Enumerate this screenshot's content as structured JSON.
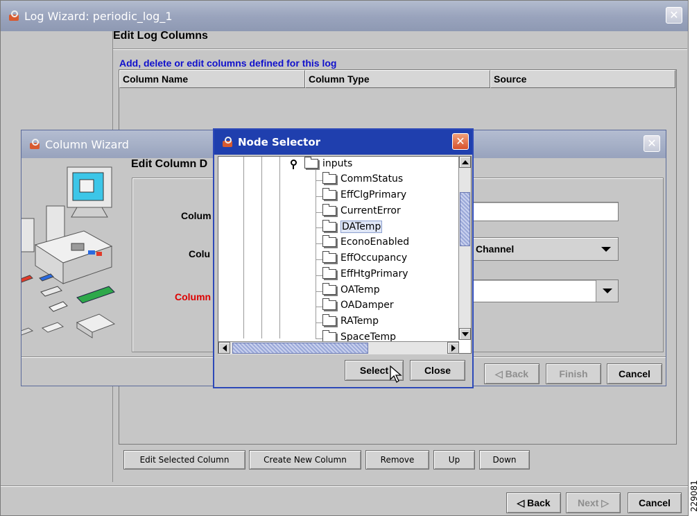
{
  "main_window": {
    "title": "Log Wizard: periodic_log_1",
    "step_heading": "Edit Log Columns",
    "caption": "Add, delete or edit columns defined for this log",
    "table": {
      "columns": [
        "Column Name",
        "Column Type",
        "Source"
      ]
    },
    "column_buttons": {
      "edit": "Edit Selected Column",
      "create": "Create New Column",
      "remove": "Remove",
      "up": "Up",
      "down": "Down"
    },
    "nav_buttons": {
      "back": "◁ Back",
      "next": "Next ▷",
      "cancel": "Cancel"
    }
  },
  "column_wizard": {
    "title": "Column Wizard",
    "step_heading": "Edit Column D",
    "labels": {
      "name": "Colum",
      "type": "Colu",
      "source": "Column"
    },
    "type_value": "Channel",
    "nav_buttons": {
      "back": "◁ Back",
      "finish": "Finish",
      "cancel": "Cancel"
    }
  },
  "node_selector": {
    "title": "Node Selector",
    "root_node": "inputs",
    "nodes": [
      "CommStatus",
      "EffClgPrimary",
      "CurrentError",
      "DATemp",
      "EconoEnabled",
      "EffOccupancy",
      "EffHtgPrimary",
      "OATemp",
      "OADamper",
      "RATemp",
      "SpaceTemp"
    ],
    "selected_node": "DATemp",
    "buttons": {
      "select": "Select",
      "close": "Close"
    }
  },
  "watermark": "229081",
  "colors": {
    "link_blue": "#1010cc",
    "required_red": "#dd0000",
    "active_title": "#1f3fae",
    "close_orange": "#d7512c"
  }
}
